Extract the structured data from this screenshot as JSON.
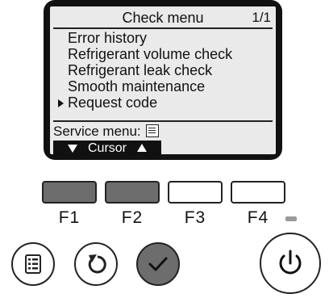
{
  "screen": {
    "title": "Check menu",
    "page": "1/1",
    "menu_items": [
      {
        "label": "Error history",
        "selected": false
      },
      {
        "label": "Refrigerant volume check",
        "selected": false
      },
      {
        "label": "Refrigerant leak check",
        "selected": false
      },
      {
        "label": "Smooth maintenance",
        "selected": false
      },
      {
        "label": "Request code",
        "selected": true
      }
    ],
    "service_menu_label": "Service menu:",
    "service_menu_icon": "menu-icon",
    "cursor_label": "Cursor"
  },
  "function_keys": [
    {
      "label": "F1",
      "active": true
    },
    {
      "label": "F2",
      "active": true
    },
    {
      "label": "F3",
      "active": false
    },
    {
      "label": "F4",
      "active": false
    }
  ],
  "buttons": {
    "menu_icon": "menu-icon",
    "return_icon": "return-icon",
    "ok_icon": "checkmark-icon",
    "power_icon": "power-icon"
  },
  "colors": {
    "lcd_background": "#eaeaea",
    "frame": "#111111",
    "active_key": "#6d6d6d",
    "inactive_key": "#ffffff",
    "power_led": "#9a9a9a"
  }
}
